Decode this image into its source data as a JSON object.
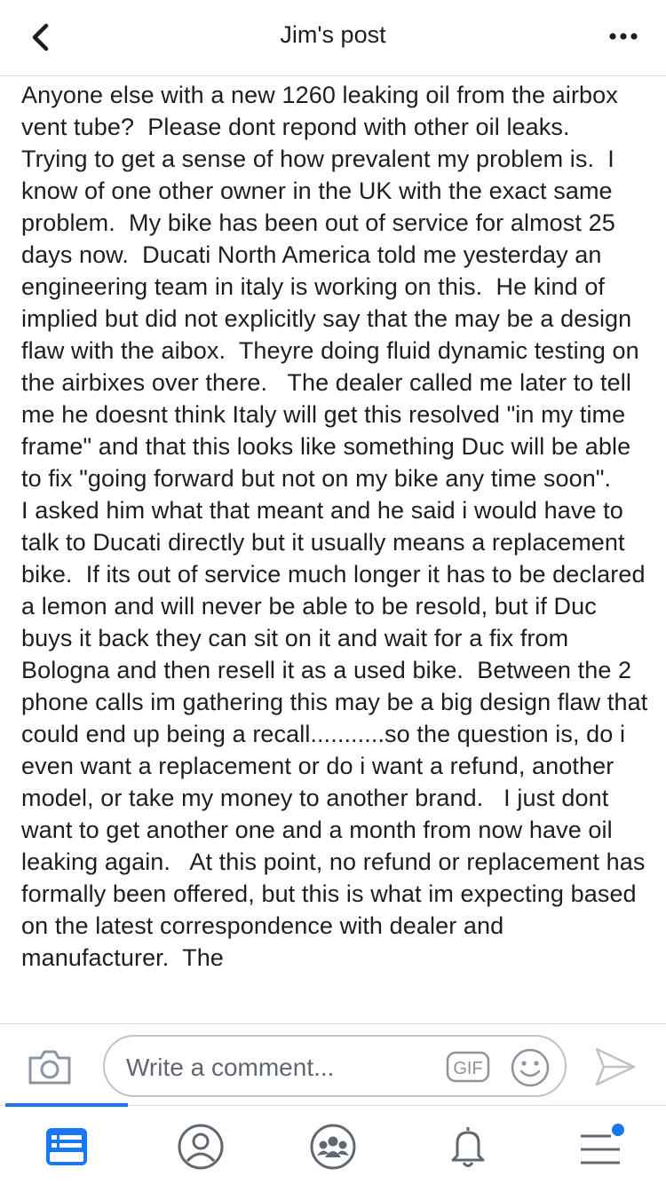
{
  "header": {
    "title": "Jim's post",
    "back_icon": "chevron-left-icon",
    "more_icon": "more-horizontal-icon"
  },
  "post": {
    "text": "Anyone else with a new 1260 leaking oil from the airbox vent tube?  Please dont repond with other oil leaks.  Trying to get a sense of how prevalent my problem is.  I know of one other owner in the UK with the exact same problem.  My bike has been out of service for almost 25 days now.  Ducati North America told me yesterday an engineering team in italy is working on this.  He kind of implied but did not explicitly say that the may be a design flaw with the aibox.  Theyre doing fluid dynamic testing on the airbixes over there.   The dealer called me later to tell me he doesnt think Italy will get this resolved \"in my time frame\" and that this looks like something Duc will be able to fix \"going forward but not on my bike any time soon\".     I asked him what that meant and he said i would have to talk to Ducati directly but it usually means a replacement bike.  If its out of service much longer it has to be declared a lemon and will never be able to be resold, but if Duc buys it back they can sit on it and wait for a fix from Bologna and then resell it as a used bike.  Between the 2 phone calls im gathering this may be a big design flaw that could end up being a recall...........so the question is, do i even want a replacement or do i want a refund, another model, or take my money to another brand.   I just dont want to get another one and a month from now have oil leaking again.   At this point, no refund or replacement has formally been offered, but this is what im expecting based on the latest correspondence with dealer and manufacturer.  The"
  },
  "comment_bar": {
    "placeholder": "Write a comment...",
    "camera_icon": "camera-icon",
    "gif_label": "GIF",
    "emoji_icon": "emoji-icon",
    "send_icon": "send-icon"
  },
  "tab_bar": {
    "active_color": "#1877f2",
    "inactive_color": "#606770",
    "tabs": [
      {
        "icon": "news-feed-icon",
        "active": true
      },
      {
        "icon": "profile-icon",
        "active": false
      },
      {
        "icon": "groups-icon",
        "active": false
      },
      {
        "icon": "notifications-bell-icon",
        "active": false
      },
      {
        "icon": "menu-icon",
        "active": false,
        "badge": true
      }
    ]
  }
}
